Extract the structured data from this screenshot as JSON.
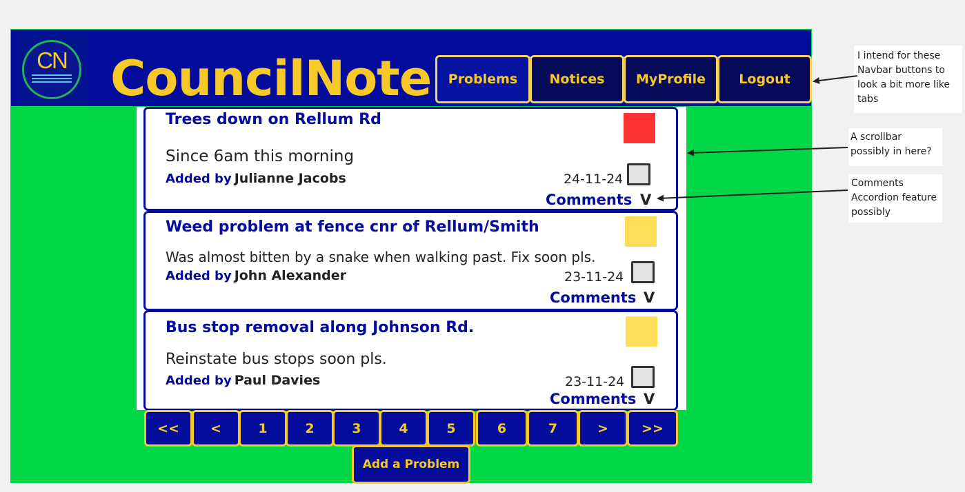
{
  "app": {
    "logo_text": "CN",
    "brand": "CouncilNote",
    "colors": {
      "background": "#00d84a",
      "header": "#040c9c",
      "accent": "#f6c928",
      "status_red": "#fe3232",
      "status_yellow": "#ffde59"
    }
  },
  "nav": {
    "items": [
      {
        "label": "Problems"
      },
      {
        "label": "Notices"
      },
      {
        "label": "MyProfile"
      },
      {
        "label": "Logout"
      }
    ]
  },
  "problems": [
    {
      "title": "Trees down on Rellum Rd",
      "description": "Since 6am this morning",
      "added_by_label": "Added by",
      "author": "Julianne Jacobs",
      "date": "24-11-24",
      "status_color": "red",
      "comments_label": "Comments",
      "toggle": "V"
    },
    {
      "title": "Weed problem at fence cnr of Rellum/Smith",
      "description": "Was almost bitten by a snake when walking past. Fix soon pls.",
      "added_by_label": "Added by",
      "author": "John Alexander",
      "date": "23-11-24",
      "status_color": "yellow",
      "comments_label": "Comments",
      "toggle": "V"
    },
    {
      "title": "Bus stop removal along Johnson Rd.",
      "description": "Reinstate bus stops soon pls.",
      "added_by_label": "Added by",
      "author": "Paul Davies",
      "date": "23-11-24",
      "status_color": "yellow",
      "comments_label": "Comments",
      "toggle": "V"
    }
  ],
  "pagination": {
    "buttons": [
      "<<",
      "<",
      "1",
      "2",
      "3",
      "4",
      "5",
      "6",
      "7",
      ">",
      ">>"
    ]
  },
  "actions": {
    "add_problem": "Add a Problem"
  },
  "annotations": {
    "navbar_note": "I intend for these Navbar buttons to look a bit more like tabs",
    "scrollbar_note": "A scrollbar possibly in here?",
    "comments_note": "Comments Accordion feature possibly"
  }
}
